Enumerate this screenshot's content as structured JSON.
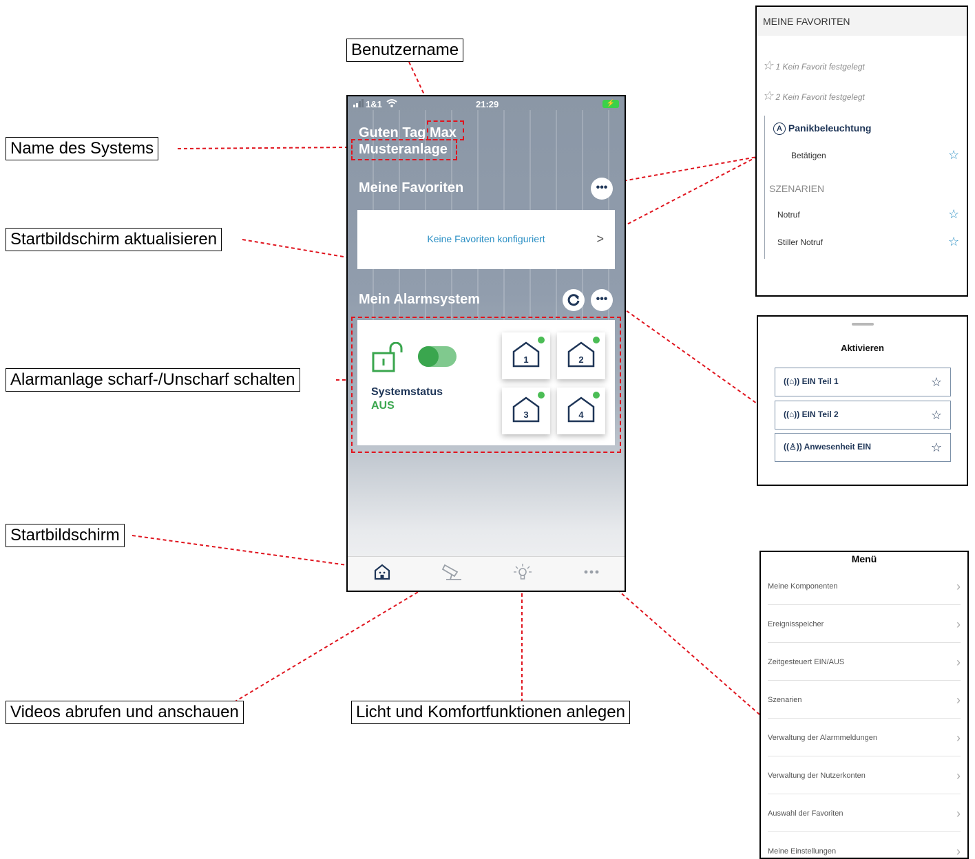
{
  "callouts": {
    "username": "Benutzername",
    "system_name": "Name des Systems",
    "refresh": "Startbildschirm aktualisieren",
    "arm": "Alarmanlage scharf-/Unscharf schalten",
    "home": "Startbildschirm",
    "videos": "Videos abrufen und anschauen",
    "light": "Licht und Komfortfunktionen anlegen"
  },
  "phone": {
    "status": {
      "carrier": "1&1",
      "time": "21:29"
    },
    "greeting": "Guten Tag",
    "user": "Max",
    "system": "Musteranlage",
    "favorites_title": "Meine Favoriten",
    "favorites_empty": "Keine Favoriten konfiguriert",
    "alarm_title": "Mein Alarmsystem",
    "status_label": "Systemstatus",
    "status_value": "AUS",
    "parts": [
      "1",
      "2",
      "3",
      "4"
    ],
    "more_glyph": "•••",
    "chevron": ">"
  },
  "favorites_panel": {
    "header": "MEINE FAVORITEN",
    "slots": [
      "1 Kein Favorit festgelegt",
      "2 Kein Favorit festgelegt"
    ],
    "group_title": "Panikbeleuchtung",
    "group_item": "Betätigen",
    "scenarios_title": "SZENARIEN",
    "scenarios": [
      "Notruf",
      "Stiller Notruf"
    ]
  },
  "activate_panel": {
    "title": "Aktivieren",
    "items": [
      "EIN Teil 1",
      "EIN Teil 2",
      "Anwesenheit EIN"
    ]
  },
  "menu_panel": {
    "title": "Menü",
    "items": [
      "Meine Komponenten",
      "Ereignisspeicher",
      "Zeitgesteuert EIN/AUS",
      "Szenarien",
      "Verwaltung der Alarmmeldungen",
      "Verwaltung der Nutzerkonten",
      "Auswahl der Favoriten",
      "Meine Einstellungen"
    ]
  },
  "colors": {
    "callout_line": "#e0141e",
    "accent_blue": "#2a8fc4",
    "navy": "#1e3557",
    "green": "#3aa64e"
  }
}
